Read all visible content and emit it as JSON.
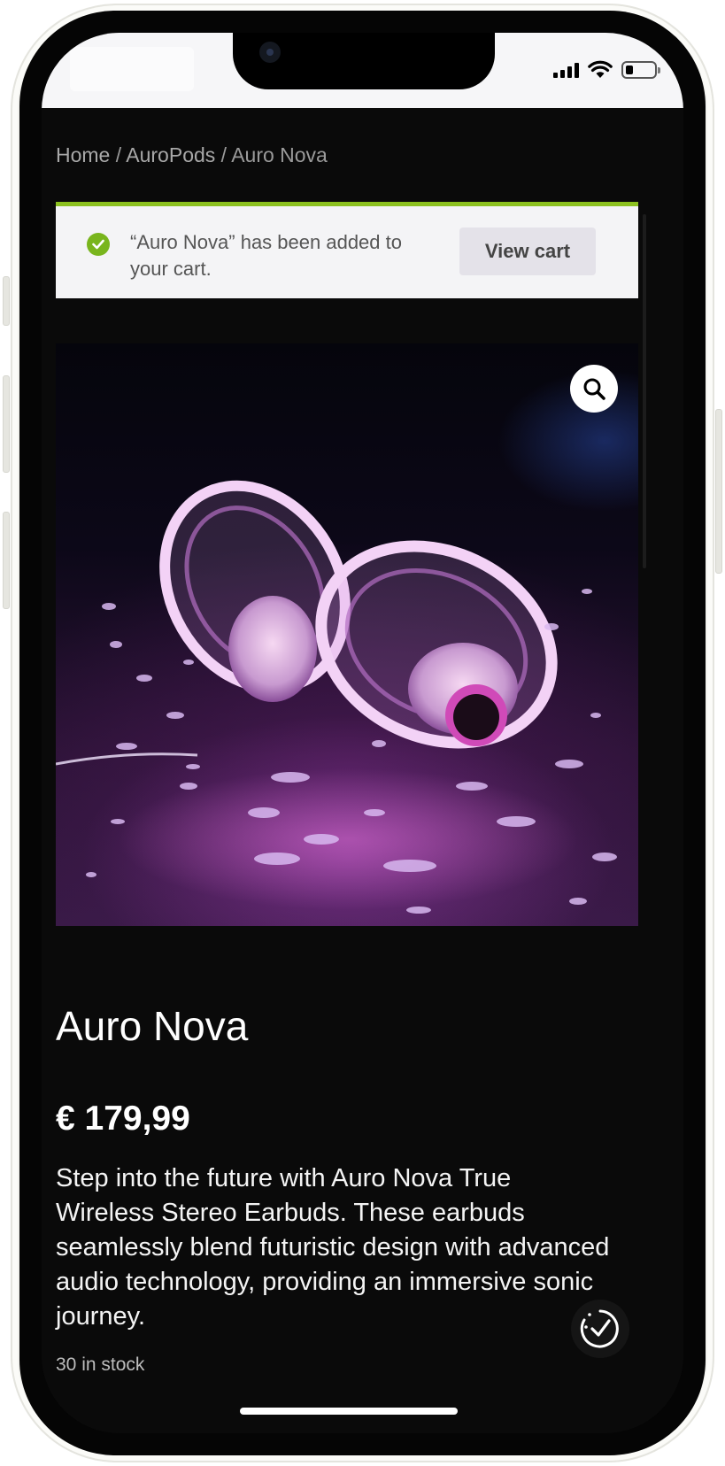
{
  "status_bar": {
    "signal_icon": "signal-bars-icon",
    "wifi_icon": "wifi-icon",
    "battery_icon": "battery-icon",
    "battery_level": 0.25
  },
  "breadcrumb": {
    "items": [
      "Home",
      "AuroPods",
      "Auro Nova"
    ],
    "separator": " / "
  },
  "notice": {
    "message": "“Auro Nova” has been added to your cart.",
    "button_label": "View cart",
    "icon": "check-circle-icon",
    "accent_color": "#8cc11f"
  },
  "product": {
    "image_icon": "product-image-earbuds",
    "zoom_icon": "search-icon",
    "title": "Auro Nova",
    "price": "€ 179,99",
    "description": "Step into the future with Auro Nova True Wireless Stereo Earbuds. These earbuds seamlessly blend futuristic design with advanced audio technology, providing an immersive sonic journey.",
    "stock": "30 in stock"
  },
  "floating_badge": {
    "icon": "checkmark-badge-icon"
  },
  "colors": {
    "page_bg": "#0a0a0a",
    "notice_bg": "#f4f4f6",
    "button_bg": "#e4e2e9",
    "text_light": "#ffffff"
  }
}
